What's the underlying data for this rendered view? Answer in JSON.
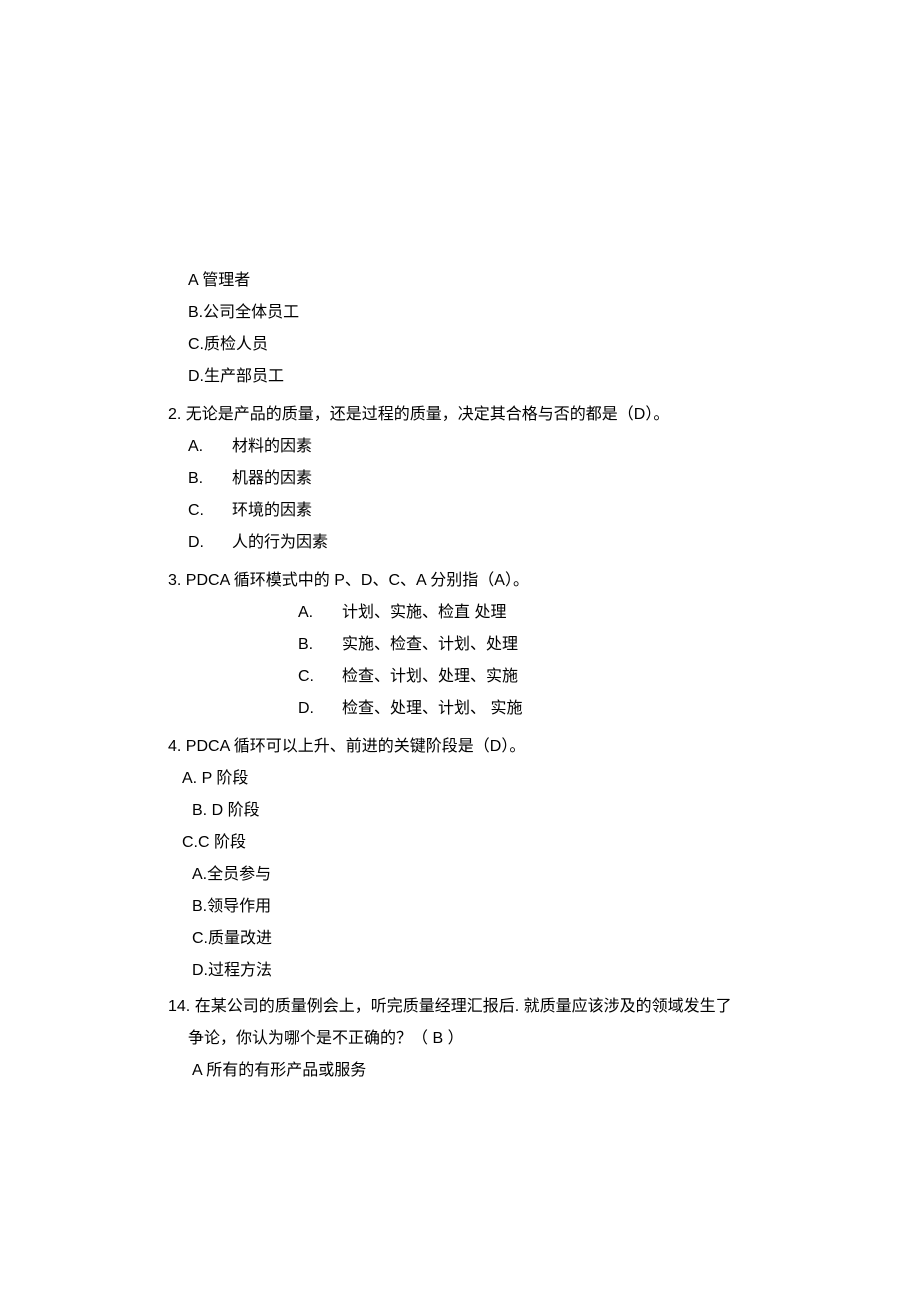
{
  "q1": {
    "optA": "A 管理者",
    "optB": "B.公司全体员工",
    "optC": "C.质检人员",
    "optD": "D.生产部员工"
  },
  "q2": {
    "stem": "2.   无论是产品的质量，还是过程的质量，决定其合格与否的都是（D）。",
    "optA_letter": "A.",
    "optA_text": "材料的因素",
    "optB_letter": "B.",
    "optB_text": "机器的因素",
    "optC_letter": "C.",
    "optC_text": "环境的因素",
    "optD_letter": "D.",
    "optD_text": "人的行为因素"
  },
  "q3": {
    "stem": "3.   PDCA 循环模式中的 P、D、C、A 分别指（A）。",
    "optA_letter": "A.",
    "optA_text": "计划、实施、检直    处理",
    "optB_letter": "B.",
    "optB_text": "实施、检查、计划、处理",
    "optC_letter": "C.",
    "optC_text": "检查、计划、处理、实施",
    "optD_letter": "D.",
    "optD_text": "检查、处理、计划、 实施"
  },
  "q4": {
    "stem": "4.   PDCA 循环可以上升、前进的关键阶段是（D）。",
    "optA": "A.   P 阶段",
    "optB": "B.   D 阶段",
    "optC": "C.C 阶段"
  },
  "q13": {
    "optA": "A.全员参与",
    "optB": "B.领导作用",
    "optC": "C.质量改进",
    "optD": "D.过程方法"
  },
  "q14": {
    "line1": "14. 在某公司的质量例会上，听完质量经理汇报后. 就质量应该涉及的领域发生了",
    "line2": "争论，你认为哪个是不正确的？（ B ）",
    "optA": "A 所有的有形产品或服务"
  }
}
